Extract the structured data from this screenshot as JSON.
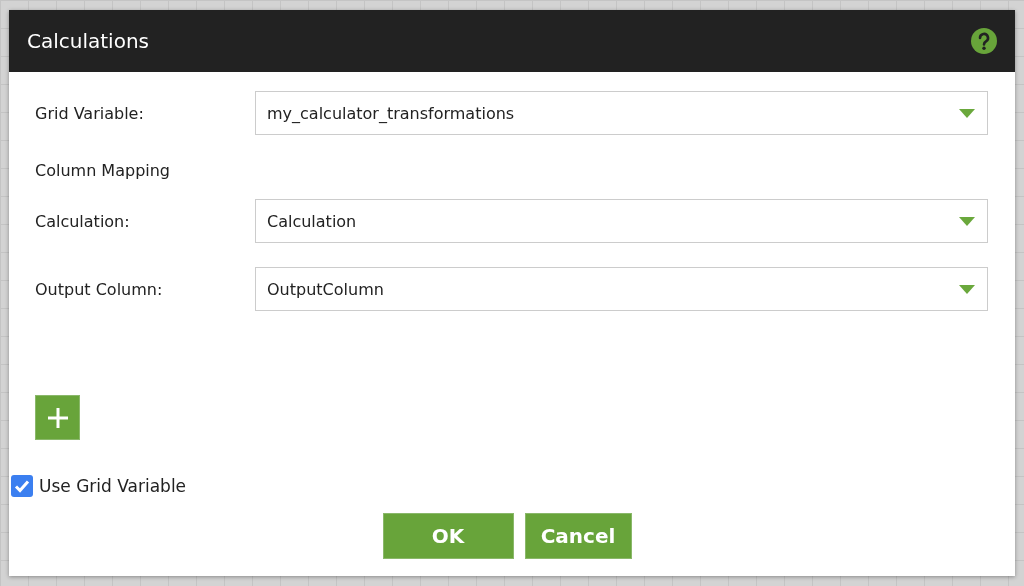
{
  "dialog": {
    "title": "Calculations"
  },
  "grid_variable": {
    "label": "Grid Variable:",
    "value": "my_calculator_transformations"
  },
  "section_title": "Column Mapping",
  "mappings": [
    {
      "label": "Calculation:",
      "value": "Calculation"
    },
    {
      "label": "Output Column:",
      "value": "OutputColumn"
    }
  ],
  "use_grid_variable": {
    "label": "Use Grid Variable",
    "checked": true
  },
  "buttons": [
    "OK",
    "Cancel"
  ]
}
